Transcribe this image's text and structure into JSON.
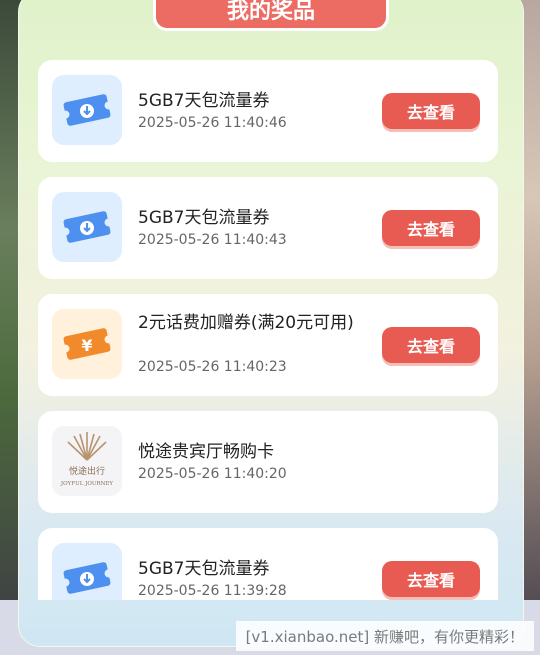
{
  "header": {
    "title": "我的奖品"
  },
  "prizes": [
    {
      "name": "5GB7天包流量券",
      "time": "2025-05-26 11:40:46",
      "icon": "blue-flow-ticket-icon",
      "button": "去查看"
    },
    {
      "name": "5GB7天包流量券",
      "time": "2025-05-26 11:40:43",
      "icon": "blue-flow-ticket-icon",
      "button": "去查看"
    },
    {
      "name": "2元话费加赠券(满20元可用)",
      "time": "2025-05-26 11:40:23",
      "icon": "orange-yuan-ticket-icon",
      "button": "去查看"
    },
    {
      "name": "悦途贵宾厅畅购卡",
      "time": "2025-05-26 11:40:20",
      "icon": "joyful-journey-logo",
      "logo_text_cn": "悦途出行",
      "logo_text_en": "JOYFUL JOURNEY",
      "button": ""
    },
    {
      "name": "5GB7天包流量券",
      "time": "2025-05-26 11:39:28",
      "icon": "blue-flow-ticket-icon",
      "button": "去查看"
    }
  ],
  "watermark": "[v1.xianbao.net] 新赚吧，有你更精彩！",
  "colors": {
    "accent": "#e85b52",
    "ticket_blue": "#4d90f0",
    "ticket_orange": "#f08a2a"
  }
}
